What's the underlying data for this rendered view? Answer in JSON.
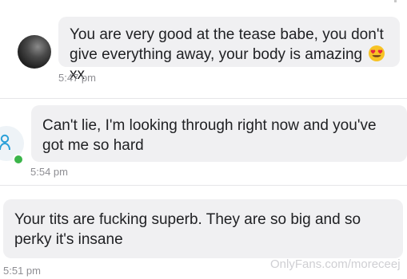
{
  "messages": [
    {
      "text": "You are very good at the tease babe, you don't give everything away, your body is amazing",
      "suffix": "xx",
      "emoji": "heart-eyes-emoji",
      "time": "5:47 pm"
    },
    {
      "text": "Can't lie, I'm looking through right now and you've got me so hard",
      "time": "5:54 pm"
    },
    {
      "text": "Your tits are fucking superb. They are so big and so perky it's insane",
      "time": "5:51 pm"
    }
  ],
  "watermark": "OnlyFans.com/moreceej",
  "colors": {
    "bubble": "#f0f0f2",
    "timestamp": "#8e8e93",
    "online": "#3bb54a",
    "emoji_face": "#f7c325",
    "emoji_heart": "#e8253d"
  }
}
